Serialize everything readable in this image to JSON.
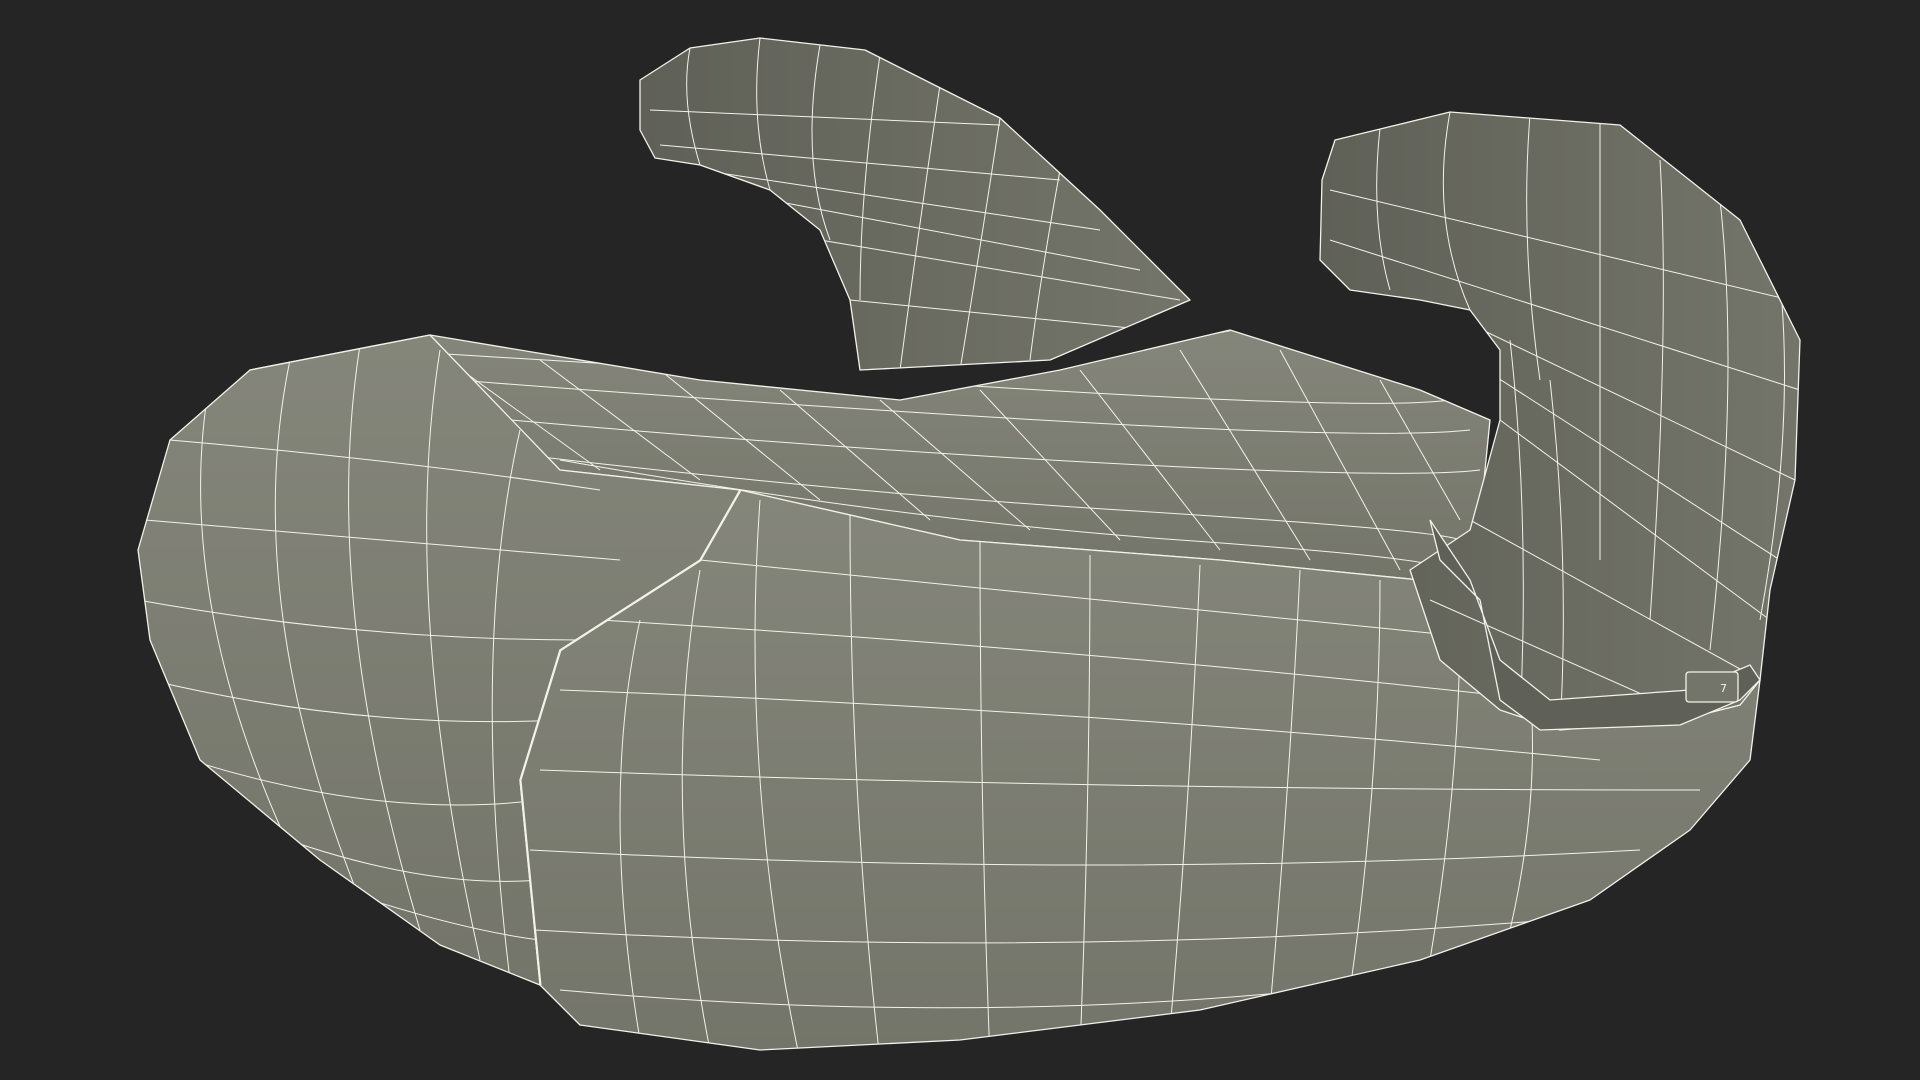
{
  "scene": {
    "subject": "booster-seat-wireframe",
    "background_color": "#252525",
    "surface_color": "#74756a",
    "surface_shadow_color": "#5f6057",
    "surface_highlight_color": "#85867b",
    "wire_color": "#f2f2ea",
    "tag_label": "7"
  }
}
